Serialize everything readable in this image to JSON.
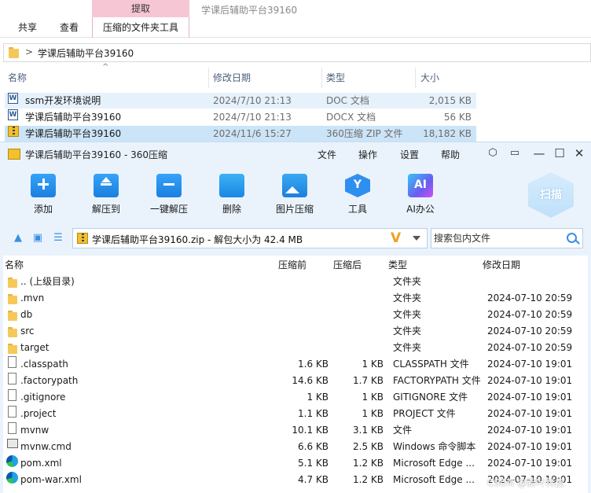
{
  "explorer": {
    "ribbon": {
      "context_header": "提取",
      "tabs": [
        "共享",
        "查看",
        "压缩的文件夹工具"
      ],
      "window_title": "学课后辅助平台39160"
    },
    "address": {
      "separator": ">",
      "path": "学课后辅助平台39160"
    },
    "columns": {
      "name": "名称",
      "modified": "修改日期",
      "type": "类型",
      "size": "大小"
    },
    "files": [
      {
        "name": "ssm开发环境说明",
        "modified": "2024/7/10 21:13",
        "type": "DOC 文档",
        "size": "2,015 KB",
        "icon": "word-doc-icon"
      },
      {
        "name": "学课后辅助平台39160",
        "modified": "2024/7/10 21:13",
        "type": "DOCX 文档",
        "size": "56 KB",
        "icon": "word-docx-icon"
      },
      {
        "name": "学课后辅助平台39160",
        "modified": "2024/11/6 15:27",
        "type": "360压缩 ZIP 文件",
        "size": "18,182 KB",
        "icon": "zip-archive-icon"
      }
    ]
  },
  "zip_app": {
    "title": "学课后辅助平台39160 - 360压缩",
    "menu": [
      "文件",
      "操作",
      "设置",
      "帮助"
    ],
    "toolbar": [
      "添加",
      "解压到",
      "一键解压",
      "删除",
      "图片压缩",
      "工具",
      "AI办公"
    ],
    "scan_label": "扫描",
    "path_text": "学课后辅助平台39160.zip - 解包大小为 42.4 MB",
    "search_placeholder": "搜索包内文件",
    "columns": {
      "name": "名称",
      "compressed_before": "压缩前",
      "compressed_after": "压缩后",
      "type": "类型",
      "modified": "修改日期"
    },
    "entries": [
      {
        "name": ".. (上级目录)",
        "before": "",
        "after": "",
        "type": "文件夹",
        "modified": "",
        "icon": "folder-icon"
      },
      {
        "name": ".mvn",
        "before": "",
        "after": "",
        "type": "文件夹",
        "modified": "2024-07-10 20:59",
        "icon": "folder-icon"
      },
      {
        "name": "db",
        "before": "",
        "after": "",
        "type": "文件夹",
        "modified": "2024-07-10 20:59",
        "icon": "folder-icon"
      },
      {
        "name": "src",
        "before": "",
        "after": "",
        "type": "文件夹",
        "modified": "2024-07-10 20:59",
        "icon": "folder-icon"
      },
      {
        "name": "target",
        "before": "",
        "after": "",
        "type": "文件夹",
        "modified": "2024-07-10 20:59",
        "icon": "folder-icon"
      },
      {
        "name": ".classpath",
        "before": "1.6 KB",
        "after": "1 KB",
        "type": "CLASSPATH 文件",
        "modified": "2024-07-10 19:01",
        "icon": "file-icon"
      },
      {
        "name": ".factorypath",
        "before": "14.6 KB",
        "after": "1.7 KB",
        "type": "FACTORYPATH 文件",
        "modified": "2024-07-10 19:01",
        "icon": "file-icon"
      },
      {
        "name": ".gitignore",
        "before": "1 KB",
        "after": "1 KB",
        "type": "GITIGNORE 文件",
        "modified": "2024-07-10 19:01",
        "icon": "file-icon"
      },
      {
        "name": ".project",
        "before": "1.1 KB",
        "after": "1 KB",
        "type": "PROJECT 文件",
        "modified": "2024-07-10 19:01",
        "icon": "file-icon"
      },
      {
        "name": "mvnw",
        "before": "10.1 KB",
        "after": "3.1 KB",
        "type": "文件",
        "modified": "2024-07-10 19:01",
        "icon": "file-icon"
      },
      {
        "name": "mvnw.cmd",
        "before": "6.6 KB",
        "after": "2.5 KB",
        "type": "Windows 命令脚本",
        "modified": "2024-07-10 19:01",
        "icon": "cmd-script-icon"
      },
      {
        "name": "pom.xml",
        "before": "5.1 KB",
        "after": "1.2 KB",
        "type": "Microsoft Edge ...",
        "modified": "2024-07-10 19:01",
        "icon": "edge-icon"
      },
      {
        "name": "pom-war.xml",
        "before": "4.7 KB",
        "after": "1.2 KB",
        "type": "Microsoft Edge ...",
        "modified": "2024-07-10 19:01",
        "icon": "edge-icon"
      }
    ]
  },
  "watermark": "CSDN @新叶科技"
}
